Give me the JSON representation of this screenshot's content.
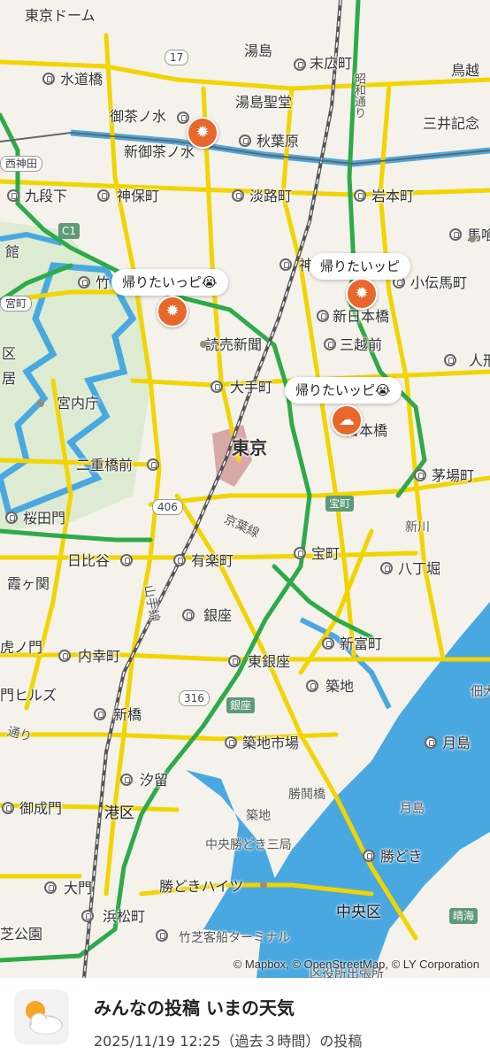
{
  "map": {
    "places": {
      "tokyo_dome": "東京ドーム",
      "yushima": "湯島",
      "suidobashi": "水道橋",
      "suehirocho": "末広町",
      "torigoe": "鳥越",
      "showa_dori": "昭和通り",
      "yushima_seido": "湯島聖堂",
      "mitsui": "三井記念",
      "ochanomizu": "御茶ノ水",
      "akihabara": "秋葉原",
      "shin_ochanomizu": "新御茶ノ水",
      "nishikanda": "西神田",
      "kudanshita": "九段下",
      "jimbocho": "神保町",
      "awajicho": "淡路町",
      "iwamotocho": "岩本町",
      "bakuro": "馬喰",
      "kan": "館",
      "take": "竹",
      "kanda": "神",
      "kodenmacho": "小伝馬町",
      "miyamachi": "宮町",
      "shin_nihombashi": "新日本橋",
      "yomiuri": "読売新聞",
      "mitsukoshimae": "三越前",
      "ku": "区",
      "kyo": "居",
      "ningyo": "人形",
      "otemachi": "大手町",
      "imperial_agency": "宮内庁",
      "nihombashi": "日本橋",
      "tokyo_station": "東京",
      "nijubashimae": "二重橋前",
      "kayabacho": "茅場町",
      "sakuradamon": "桜田門",
      "takaracho": "宝町",
      "keiyo_line": "京葉線",
      "shinkawa": "新川",
      "hibiya": "日比谷",
      "yurakucho": "有楽町",
      "takaracho_st": "宝町",
      "hatchobori": "八丁堀",
      "kasumigaseki": "霞ヶ関",
      "yamanote": "山手線",
      "ginza_st": "銀座",
      "toranomon": "虎ノ門",
      "uchisaiwaicho": "内幸町",
      "higashi_ginza": "東銀座",
      "shintomicho": "新富町",
      "tsukudaohashi": "佃大橋",
      "mori_hills": "門ヒルズ",
      "tsukiji": "築地",
      "shimbashi": "新橋",
      "ginza": "銀座",
      "tsukiji_shijo": "築地市場",
      "tsukishima": "月島",
      "dori": "通り",
      "shiodome": "汐留",
      "kachidoki_bridge": "勝鬨橋",
      "onarimon": "御成門",
      "minato_ku": "港区",
      "tsukiji2": "築地",
      "tsukishima2": "月島",
      "chuo_kachidoki": "中央勝どき三局",
      "kachidoki": "勝どき",
      "daimon": "大門",
      "kachidoki_heights": "勝どきハイツ",
      "hamamatsucho": "浜松町",
      "chuo_ku": "中央区",
      "harumi": "晴海",
      "shiba_park": "芝公園",
      "takeshiba": "竹芝客船ターミナル",
      "ward_office": "区役所出張所"
    },
    "route_numbers": [
      "17",
      "406",
      "316"
    ],
    "shields": [
      "C1"
    ],
    "posts": [
      {
        "bubble": "帰りたいっピ😭",
        "icon": "sun-icon"
      },
      {
        "bubble": "帰りたいッピ",
        "icon": "sun-icon"
      },
      {
        "bubble": "帰りたいッピ😭",
        "icon": "sun-cloud-icon"
      }
    ],
    "extra_marker_icon": "sun-icon",
    "attribution": "© Mapbox, © OpenStreetMap, © LY Corporation"
  },
  "sheet": {
    "title": "みんなの投稿  いまの天気",
    "subtitle": "2025/11/19 12:25（過去３時間）の投稿",
    "icon": "sun-cloud-icon"
  },
  "colors": {
    "land": "#f4f2ea",
    "water": "#4aa8e0",
    "park": "#dcebd2",
    "main_road": "#f2d400",
    "expressway": "#2eaa4a",
    "marker": "#e8672a"
  }
}
